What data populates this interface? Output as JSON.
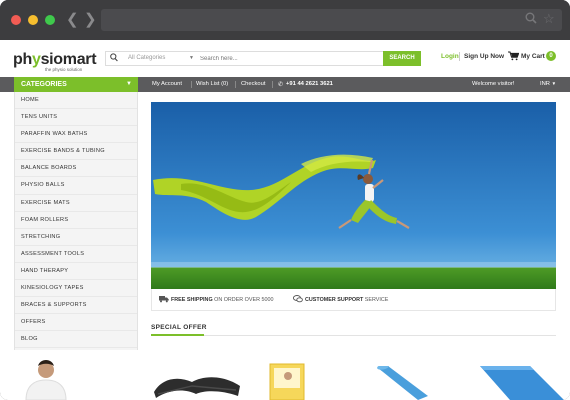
{
  "header": {
    "logo_pre": "ph",
    "logo_o": "y",
    "logo_post": "siomart",
    "tagline": "the physio solution",
    "search": {
      "category": "All Categories",
      "placeholder": "Search here...",
      "button": "SEARCH"
    },
    "login": "Login",
    "signup": "Sign Up Now",
    "cart_label": "My Cart",
    "cart_count": "0"
  },
  "nav": {
    "categories_label": "CATEGORIES",
    "items": [
      "My Account",
      "Wish List (0)",
      "Checkout"
    ],
    "phone": "+91 44 2621 3621",
    "welcome": "Welcome visitor!",
    "currency": "INR"
  },
  "sidebar": {
    "items": [
      "HOME",
      "TENS UNITS",
      "PARAFFIN WAX BATHS",
      "EXERCISE BANDS & TUBING",
      "BALANCE BOARDS",
      "PHYSIO BALLS",
      "EXERCISE MATS",
      "FOAM ROLLERS",
      "STRETCHING",
      "ASSESSMENT TOOLS",
      "HAND THERAPY",
      "KINESIOLOGY TAPES",
      "BRACES & SUPPORTS",
      "OFFERS",
      "BLOG"
    ]
  },
  "info": {
    "shipping_bold": "FREE SHIPPING",
    "shipping_rest": " ON ORDER OVER 5000",
    "support_bold": "CUSTOMER SUPPORT",
    "support_rest": " SERVICE"
  },
  "special_offer": "SPECIAL OFFER",
  "colors": {
    "accent": "#7cbf2a",
    "navbar": "#5b5b5d",
    "sky": "#1f6fb8"
  }
}
